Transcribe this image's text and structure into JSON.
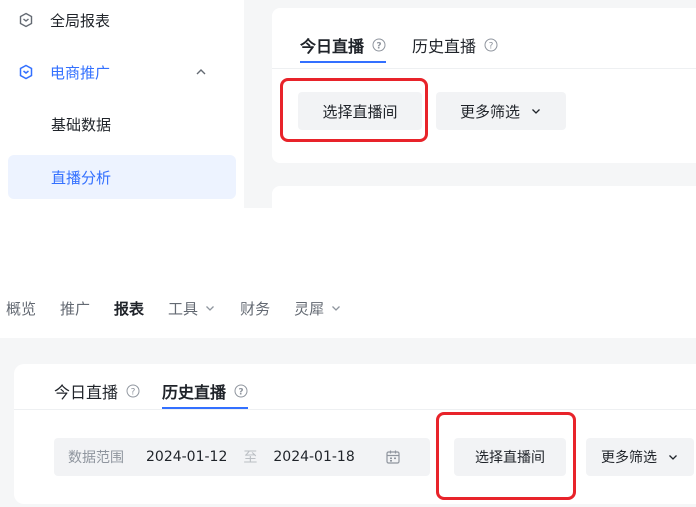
{
  "sidebar": {
    "items": [
      {
        "label": "全局报表",
        "icon": "shield-icon"
      },
      {
        "label": "电商推广",
        "icon": "shield-icon",
        "expanded": true
      },
      {
        "label": "基础数据"
      },
      {
        "label": "直播分析",
        "active": true
      }
    ]
  },
  "top": {
    "tabs": [
      {
        "label": "今日直播",
        "active": true
      },
      {
        "label": "历史直播",
        "active": false
      }
    ],
    "select_room_label": "选择直播间",
    "more_filter_label": "更多筛选"
  },
  "nav": {
    "items": [
      {
        "label": "概览"
      },
      {
        "label": "推广"
      },
      {
        "label": "报表",
        "active": true
      },
      {
        "label": "工具",
        "has_dropdown": true
      },
      {
        "label": "财务"
      },
      {
        "label": "灵犀",
        "has_dropdown": true
      }
    ]
  },
  "bottom": {
    "tabs": [
      {
        "label": "今日直播",
        "active": false
      },
      {
        "label": "历史直播",
        "active": true
      }
    ],
    "date_range": {
      "label": "数据范围",
      "start": "2024-01-12",
      "separator": "至",
      "end": "2024-01-18"
    },
    "select_room_label": "选择直播间",
    "more_filter_label": "更多筛选"
  },
  "colors": {
    "accent": "#3370ff",
    "highlight": "#e8232a",
    "page_bg": "#f5f6f7"
  }
}
